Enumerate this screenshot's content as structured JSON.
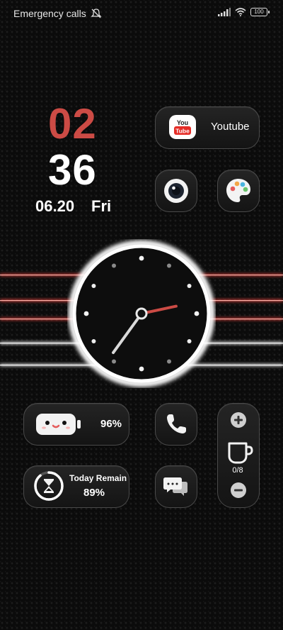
{
  "status_bar": {
    "carrier_text": "Emergency calls",
    "battery": "100",
    "icons": [
      "mute-icon",
      "signal-icon",
      "wifi-icon",
      "battery-icon"
    ]
  },
  "clock": {
    "hour": "02",
    "minute": "36",
    "date": "06.20",
    "weekday": "Fri",
    "accent_color": "#cc4b45"
  },
  "widgets": {
    "youtube": {
      "label": "Youtube",
      "logo_text": "You Tube"
    },
    "camera": {
      "icon": "camera-icon"
    },
    "themes": {
      "icon": "palette-icon"
    },
    "battery": {
      "percent": "96%",
      "level": 0.96
    },
    "today_remain": {
      "label": "Today Remain",
      "value": "89%",
      "level": 0.89
    },
    "phone": {
      "icon": "phone-icon"
    },
    "messages": {
      "icon": "messages-icon"
    },
    "water": {
      "count": "0/8"
    }
  },
  "analog_clock": {
    "hour_hand": "02",
    "minute_hand": "36"
  }
}
